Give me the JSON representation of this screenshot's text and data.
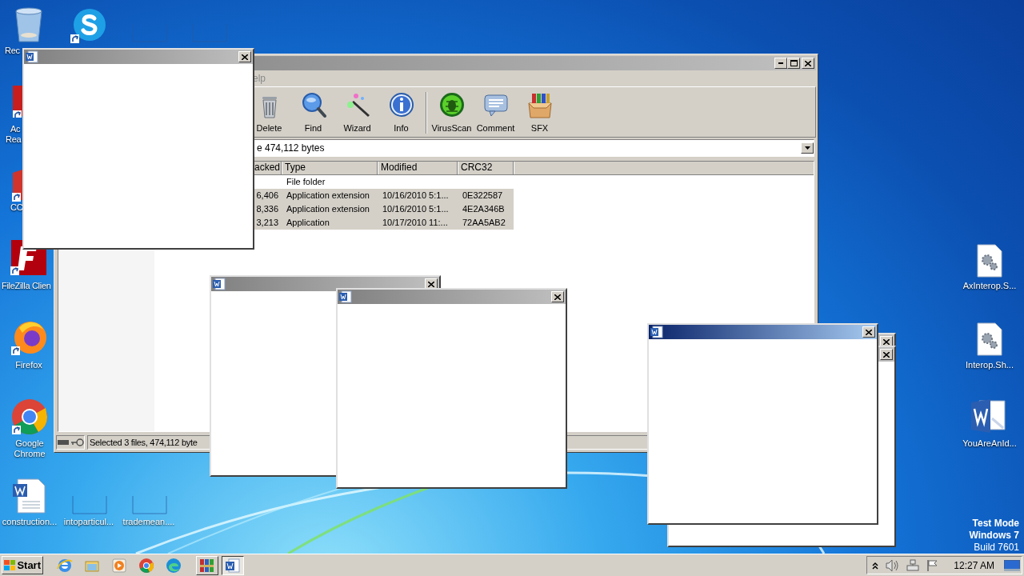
{
  "desktop_icons": [
    {
      "kind": "recycle-bin",
      "label_lines": [
        "Rec"
      ]
    },
    {
      "kind": "skype"
    },
    {
      "kind": "blank"
    },
    {
      "kind": "blank"
    },
    {
      "kind": "pdf",
      "label_lines": [
        "Ac",
        "Rea"
      ]
    },
    {
      "kind": "cleaner",
      "label_lines": [
        "CC"
      ]
    },
    {
      "kind": "filezilla",
      "label_lines": [
        "FileZilla Clien"
      ]
    },
    {
      "kind": "firefox",
      "label_lines": [
        "Firefox"
      ]
    },
    {
      "kind": "chrome",
      "label_lines": [
        "Google",
        "Chrome"
      ]
    },
    {
      "kind": "word-doc",
      "label_lines": [
        "construction..."
      ]
    },
    {
      "kind": "blank",
      "label_lines": [
        "intoparticul..."
      ]
    },
    {
      "kind": "blank",
      "label_lines": [
        "trademean...."
      ]
    },
    {
      "kind": "settings-file",
      "label_lines": [
        "AxInterop.S..."
      ]
    },
    {
      "kind": "settings-file",
      "label_lines": [
        "Interop.Sh..."
      ]
    },
    {
      "kind": "word",
      "label_lines": [
        "YouAreAnId..."
      ]
    }
  ],
  "os_watermark": [
    "Test Mode",
    "Windows 7",
    "Build 7601"
  ],
  "archiver_window": {
    "active": false,
    "menu": [
      "elp"
    ],
    "toolbar": [
      {
        "kind": "delete",
        "label": "Delete"
      },
      {
        "kind": "find",
        "label": "Find"
      },
      {
        "kind": "wizard",
        "label": "Wizard"
      },
      {
        "kind": "info",
        "label": "Info"
      },
      {
        "kind": "separator"
      },
      {
        "kind": "virusscan",
        "label": "VirusScan"
      },
      {
        "kind": "comment",
        "label": "Comment"
      },
      {
        "kind": "sfx",
        "label": "SFX"
      }
    ],
    "address": "e 474,112 bytes",
    "columns": [
      "acked",
      "Type",
      "Modified",
      "CRC32"
    ],
    "rows": [
      {
        "cells": [
          "",
          "File folder",
          "",
          ""
        ],
        "selected": false
      },
      {
        "cells": [
          "6,406",
          "Application extension",
          "10/16/2010 5:1...",
          "0E322587"
        ],
        "selected": true
      },
      {
        "cells": [
          "8,336",
          "Application extension",
          "10/16/2010 5:1...",
          "4E2A346B"
        ],
        "selected": true
      },
      {
        "cells": [
          "3,213",
          "Application",
          "10/17/2010 11:...",
          "72AA5AB2"
        ],
        "selected": true
      }
    ],
    "status": "Selected 3 files, 474,112 byte"
  },
  "dialogs": [
    {
      "active": false
    },
    {
      "active": false
    },
    {
      "active": true,
      "icon": true
    },
    {
      "active": false,
      "icon": true
    },
    {
      "active": false,
      "icon": true
    },
    {
      "active": false,
      "icon": true
    }
  ],
  "taskbar": {
    "start": "Start",
    "quick_launch": [
      {
        "kind": "ie"
      },
      {
        "kind": "explorer"
      },
      {
        "kind": "media"
      },
      {
        "kind": "chrome"
      },
      {
        "kind": "edge"
      }
    ],
    "tasks": [
      {
        "kind": "winrar",
        "selected": false
      },
      {
        "kind": "word",
        "selected": true
      }
    ],
    "time": "12:27 AM"
  }
}
